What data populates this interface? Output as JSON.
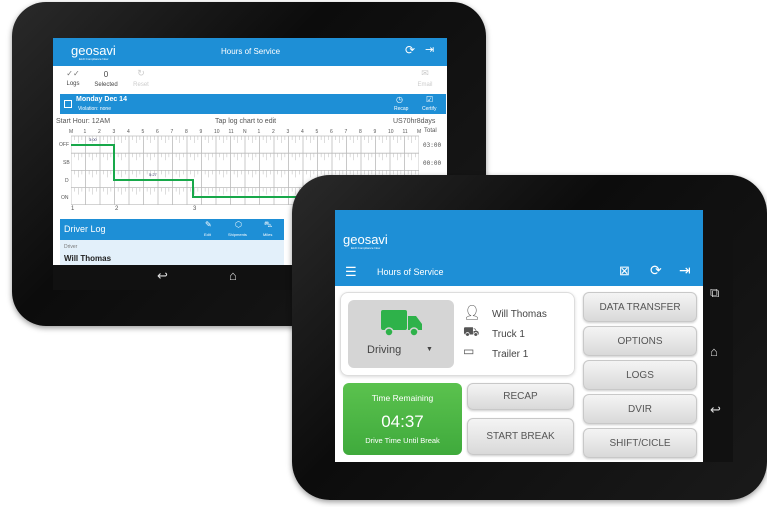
{
  "back": {
    "logo": "geosavi",
    "logo_tagline": "ELD Compliance Now",
    "title": "Hours of Service",
    "toolbar": {
      "logs": "Logs",
      "selected_count": "0",
      "selected": "Selected",
      "reset": "Reset",
      "email": "Email"
    },
    "day": {
      "date": "Monday Dec 14",
      "violation": "Violation: none",
      "recap": "Recap",
      "certify": "Certify"
    },
    "chart_bar": {
      "start_hour": "Start Hour: 12AM",
      "hint": "Tap log chart to edit",
      "rule": "US70hr8days"
    },
    "hours": [
      "M",
      "1",
      "2",
      "3",
      "4",
      "5",
      "6",
      "7",
      "8",
      "9",
      "10",
      "11",
      "N",
      "1",
      "2",
      "3",
      "4",
      "5",
      "6",
      "7",
      "8",
      "9",
      "10",
      "11",
      "M"
    ],
    "total_label": "Total",
    "rows": [
      {
        "label": "OFF",
        "total": "03:00"
      },
      {
        "label": "SB",
        "total": "00:00"
      },
      {
        "label": "D",
        "total": ""
      },
      {
        "label": "ON",
        "total": ""
      }
    ],
    "segment_labels": [
      "3:00",
      "5:27"
    ],
    "bottom_marks": [
      "1",
      "2",
      "3"
    ],
    "driver_log": {
      "title": "Driver Log",
      "edit": "Edit",
      "shipments": "Shipments",
      "miles": "Miles",
      "driver_label": "Driver",
      "driver_name": "Will Thomas"
    }
  },
  "front": {
    "logo": "geosavi",
    "logo_tagline": "ELD Compliance Now",
    "title": "Hours of Service",
    "status": "Driving",
    "driver": "Will Thomas",
    "truck": "Truck 1",
    "trailer": "Trailer 1",
    "time_remaining_label": "Time Remaining",
    "time_remaining": "04:37",
    "time_caption": "Drive Time Until Break",
    "recap": "RECAP",
    "start_break": "START BREAK",
    "menu": [
      "DATA TRANSFER",
      "OPTIONS",
      "LOGS",
      "DVIR",
      "SHIFT/CICLE"
    ],
    "colors": {
      "header": "#1e8fd6",
      "driving": "#2eb24a",
      "time_box": "#4cb848"
    }
  }
}
